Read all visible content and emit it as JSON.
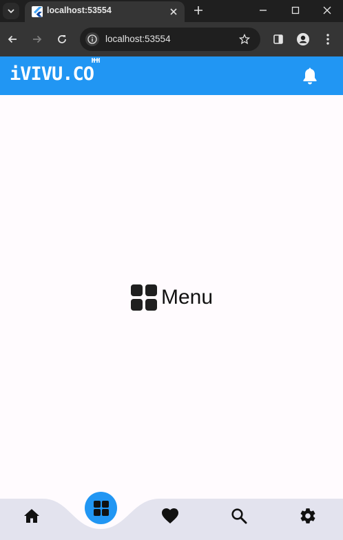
{
  "browser": {
    "tab_title": "localhost:53554",
    "url": "localhost:53554"
  },
  "app": {
    "logo_text": "iVIVU.CO",
    "logo_mark": "⌂",
    "accent_color": "#2196f3"
  },
  "content": {
    "center_label": "Menu",
    "center_icon": "grid-icon"
  },
  "bottom_nav": {
    "items": [
      {
        "name": "home",
        "icon": "home-icon"
      },
      {
        "name": "menu",
        "icon": "grid-icon",
        "active": true
      },
      {
        "name": "favorites",
        "icon": "heart-icon"
      },
      {
        "name": "search",
        "icon": "search-icon"
      },
      {
        "name": "settings",
        "icon": "gear-icon"
      }
    ]
  }
}
